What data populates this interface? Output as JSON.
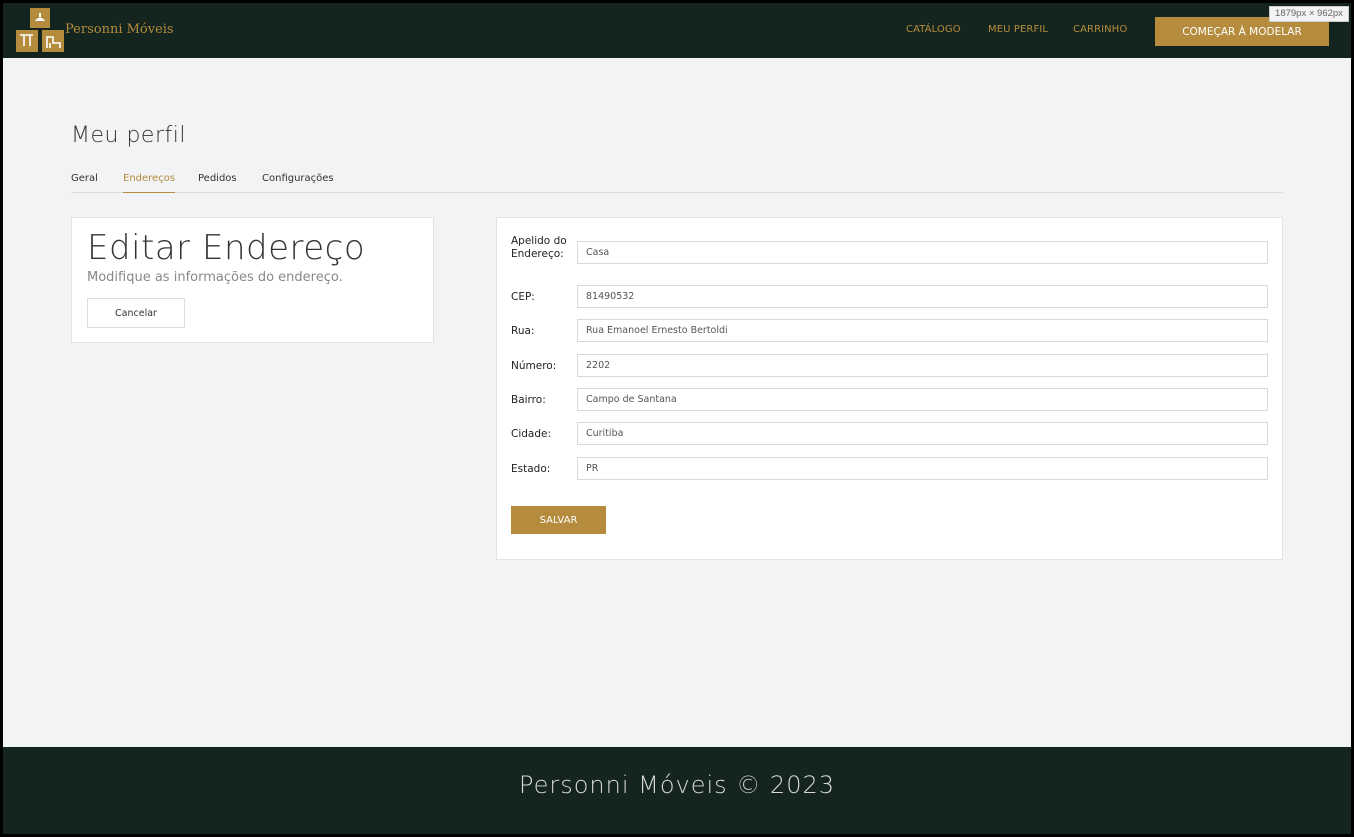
{
  "header": {
    "brand": "Personni Móveis",
    "nav": {
      "catalog": "CATÁLOGO",
      "profile": "MEU PERFIL",
      "cart": "CARRINHO"
    },
    "cta": "COMEÇAR À MODELAR",
    "dimension_badge": "1879px × 962px"
  },
  "page": {
    "title": "Meu perfil",
    "tabs": [
      {
        "label": "Geral"
      },
      {
        "label": "Endereços"
      },
      {
        "label": "Pedidos"
      },
      {
        "label": "Configurações"
      }
    ],
    "active_tab": "Endereços"
  },
  "left_card": {
    "title": "Editar Endereço",
    "subtitle": "Modifique as informações do endereço.",
    "cancel": "Cancelar"
  },
  "form": {
    "nickname": {
      "label": "Apelido do Endereço:",
      "value": "Casa"
    },
    "cep": {
      "label": "CEP:",
      "value": "81490532"
    },
    "street": {
      "label": "Rua:",
      "value": "Rua Emanoel Ernesto Bertoldi"
    },
    "number": {
      "label": "Número:",
      "value": "2202"
    },
    "neighborhood": {
      "label": "Bairro:",
      "value": "Campo de Santana"
    },
    "city": {
      "label": "Cidade:",
      "value": "Curitiba"
    },
    "state": {
      "label": "Estado:",
      "value": "PR"
    },
    "save": "SALVAR"
  },
  "footer": {
    "text": "Personni Móveis © 2023"
  },
  "colors": {
    "header_bg": "#14251f",
    "accent": "#b58c3d",
    "page_bg": "#f2f3f4"
  }
}
